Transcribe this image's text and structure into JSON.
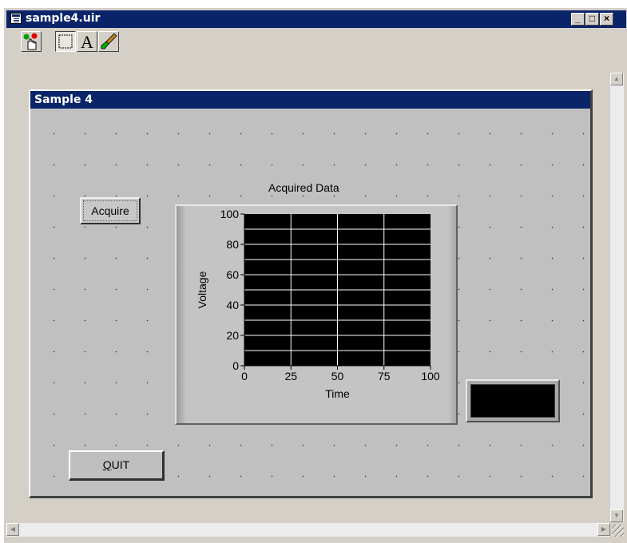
{
  "window": {
    "title": "sample4.uir",
    "minimize_glyph": "_",
    "maximize_glyph": "□",
    "close_glyph": "×"
  },
  "toolbar": {
    "tools": [
      {
        "icon": "operate-hand-icon"
      },
      {
        "icon": "select-rectangle-icon"
      },
      {
        "icon": "text-tool-icon",
        "glyph": "A"
      },
      {
        "icon": "color-brush-icon"
      }
    ]
  },
  "panel": {
    "title": "Sample 4",
    "acquire_label": "Acquire",
    "quit_label_mnemonic": "Q",
    "quit_label_rest": "UIT"
  },
  "chart_data": {
    "type": "line",
    "title": "Acquired Data",
    "xlabel": "Time",
    "ylabel": "Voltage",
    "xlim": [
      0,
      100
    ],
    "ylim": [
      0,
      100
    ],
    "x_ticks": [
      0,
      25,
      50,
      75,
      100
    ],
    "y_ticks": [
      0,
      20,
      40,
      60,
      80,
      100
    ],
    "y_gridlines": [
      10,
      20,
      30,
      40,
      50,
      60,
      70,
      80,
      90
    ],
    "x_gridlines": [
      25,
      50,
      75
    ],
    "grid": true,
    "series": [],
    "plot_background": "#000000",
    "grid_color": "#ffffff"
  },
  "colors": {
    "titlebar": "#0a246a",
    "panel_bg": "#c0c0c0",
    "window_bg": "#d4d0c8"
  }
}
